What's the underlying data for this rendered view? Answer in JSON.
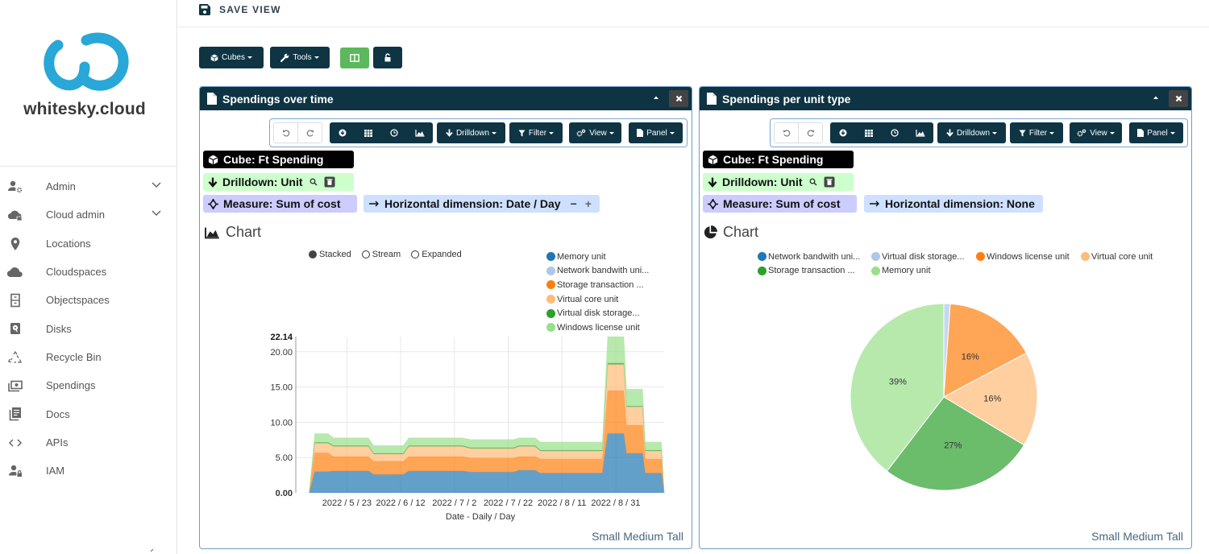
{
  "sidebar": {
    "brand": "whitesky.cloud",
    "items": [
      {
        "label": "Admin",
        "icon": "admin-icon",
        "expandable": true
      },
      {
        "label": "Cloud admin",
        "icon": "cloud-lock-icon",
        "expandable": true
      },
      {
        "label": "Locations",
        "icon": "map-pin-icon"
      },
      {
        "label": "Cloudspaces",
        "icon": "cloud-icon"
      },
      {
        "label": "Objectspaces",
        "icon": "cabinet-icon"
      },
      {
        "label": "Disks",
        "icon": "hard-disk-icon"
      },
      {
        "label": "Recycle Bin",
        "icon": "recycle-icon"
      },
      {
        "label": "Spendings",
        "icon": "money-icon"
      },
      {
        "label": "Docs",
        "icon": "docs-icon"
      },
      {
        "label": "APIs",
        "icon": "code-icon"
      },
      {
        "label": "IAM",
        "icon": "user-lock-icon"
      }
    ]
  },
  "header": {
    "save_view_label": "SAVE VIEW"
  },
  "toolbar": {
    "cubes_label": "Cubes",
    "tools_label": "Tools",
    "colors": {
      "dark": "#0f3444",
      "green": "#5cb85c"
    }
  },
  "panels": [
    {
      "title": "Spendings over time",
      "toolbar": {
        "drilldown": "Drilldown",
        "filter": "Filter",
        "view": "View",
        "panel": "Panel"
      },
      "chips": {
        "cube": "Cube: Ft Spending",
        "drilldown": "Drilldown: Unit",
        "measure": "Measure: Sum of cost",
        "horizontal": "Horizontal dimension: Date / Day",
        "minus": "−",
        "plus": "+"
      },
      "chart_heading": "Chart",
      "modes": [
        {
          "label": "Stacked",
          "selected": true
        },
        {
          "label": "Stream",
          "selected": false
        },
        {
          "label": "Expanded",
          "selected": false
        }
      ],
      "size_options": [
        "Small",
        "Medium",
        "Tall"
      ]
    },
    {
      "title": "Spendings per unit type",
      "toolbar": {
        "drilldown": "Drilldown",
        "filter": "Filter",
        "view": "View",
        "panel": "Panel"
      },
      "chips": {
        "cube": "Cube: Ft Spending",
        "drilldown": "Drilldown: Unit",
        "measure": "Measure: Sum of cost",
        "horizontal": "Horizontal dimension: None"
      },
      "chart_heading": "Chart",
      "size_options": [
        "Small",
        "Medium",
        "Tall"
      ]
    }
  ],
  "chart_data": [
    {
      "type": "area",
      "title": "Spendings over time",
      "stacking": "stacked",
      "xlabel": "Date - Daily / Day",
      "ylabel": "",
      "ylim": [
        0,
        22.14
      ],
      "ymax_label": "22.14",
      "x_domain": [
        "2022-05-04",
        "2022-09-18"
      ],
      "grid": true,
      "legend_position": "top-right",
      "yticks": [
        {
          "value": 0,
          "label": "0.00"
        },
        {
          "value": 5,
          "label": "5.00"
        },
        {
          "value": 10,
          "label": "10.00"
        },
        {
          "value": 15,
          "label": "15.00"
        },
        {
          "value": 20,
          "label": "20.00"
        }
      ],
      "xticks": [
        {
          "date": "2022-05-23",
          "label": "2022 / 5 / 23"
        },
        {
          "date": "2022-06-12",
          "label": "2022 / 6 / 12"
        },
        {
          "date": "2022-07-02",
          "label": "2022 / 7 / 2"
        },
        {
          "date": "2022-07-22",
          "label": "2022 / 7 / 22"
        },
        {
          "date": "2022-08-11",
          "label": "2022 / 8 / 11"
        },
        {
          "date": "2022-08-31",
          "label": "2022 / 8 / 31"
        }
      ],
      "x": [
        "2022-05-09",
        "2022-05-11",
        "2022-05-16",
        "2022-05-18",
        "2022-05-31",
        "2022-06-02",
        "2022-06-13",
        "2022-06-15",
        "2022-07-05",
        "2022-07-08",
        "2022-07-24",
        "2022-07-26",
        "2022-08-01",
        "2022-08-03",
        "2022-08-26",
        "2022-08-28",
        "2022-09-03",
        "2022-09-04",
        "2022-09-10",
        "2022-09-11",
        "2022-09-17",
        "2022-09-18"
      ],
      "series": [
        {
          "name": "Memory unit",
          "color": "#1f77b4",
          "values": [
            0,
            3.0,
            3.0,
            3.1,
            3.1,
            2.6,
            2.6,
            3.1,
            3.1,
            2.95,
            2.95,
            3.2,
            3.2,
            2.8,
            2.8,
            8.4,
            8.4,
            5.6,
            5.6,
            2.8,
            2.8,
            0
          ]
        },
        {
          "name": "Network bandwith uni...",
          "color": "#aec7e8",
          "values": [
            0,
            0,
            0,
            0,
            0,
            0,
            0,
            0,
            0,
            0,
            0,
            0,
            0,
            0,
            0,
            0,
            0,
            0,
            0,
            0,
            0,
            0
          ]
        },
        {
          "name": "Storage transaction ...",
          "color": "#ff7f0e",
          "values": [
            0,
            2.7,
            2.7,
            2.05,
            2.05,
            1.9,
            1.9,
            2.05,
            2.05,
            2.0,
            2.0,
            1.95,
            1.95,
            2.0,
            2.0,
            6.1,
            6.1,
            4.0,
            4.0,
            2.0,
            2.0,
            0
          ]
        },
        {
          "name": "Virtual core unit",
          "color": "#ffbb78",
          "values": [
            0,
            1.35,
            1.35,
            1.45,
            1.45,
            1.0,
            1.0,
            1.45,
            1.45,
            1.35,
            1.35,
            1.45,
            1.45,
            1.15,
            1.15,
            3.7,
            3.7,
            2.6,
            2.6,
            1.15,
            1.15,
            0
          ]
        },
        {
          "name": "Virtual disk storage...",
          "color": "#2ca02c",
          "values": [
            0,
            0.1,
            0.1,
            0.1,
            0.1,
            0.1,
            0.1,
            0.1,
            0.1,
            0.1,
            0.1,
            0.1,
            0.1,
            0.1,
            0.1,
            0.2,
            0.2,
            0.1,
            0.1,
            0.1,
            0.1,
            0
          ]
        },
        {
          "name": "Windows license unit",
          "color": "#98df8a",
          "values": [
            0,
            1.25,
            1.25,
            1.1,
            1.1,
            1.1,
            1.1,
            1.1,
            1.1,
            1.15,
            1.15,
            1.1,
            1.1,
            1.15,
            1.15,
            3.74,
            3.74,
            2.4,
            2.4,
            1.15,
            1.15,
            0
          ]
        }
      ]
    },
    {
      "type": "pie",
      "title": "Spendings per unit type",
      "legend_position": "top",
      "start_angle": "top",
      "direction": "clockwise",
      "slices": [
        {
          "label": "Network bandwith uni...",
          "color": "#1f77b4",
          "value": 0.0,
          "data_label": ""
        },
        {
          "label": "Virtual disk storage...",
          "color": "#aec7e8",
          "value": 1.1,
          "data_label": ""
        },
        {
          "label": "Windows license unit",
          "color": "#ff7f0e",
          "value": 16.1,
          "data_label": "16%"
        },
        {
          "label": "Virtual core unit",
          "color": "#ffbb78",
          "value": 16.4,
          "data_label": "16%"
        },
        {
          "label": "Storage transaction ...",
          "color": "#2ca02c",
          "value": 26.8,
          "data_label": "27%"
        },
        {
          "label": "Memory unit",
          "color": "#98df8a",
          "value": 39.6,
          "data_label": "39%"
        }
      ]
    }
  ]
}
